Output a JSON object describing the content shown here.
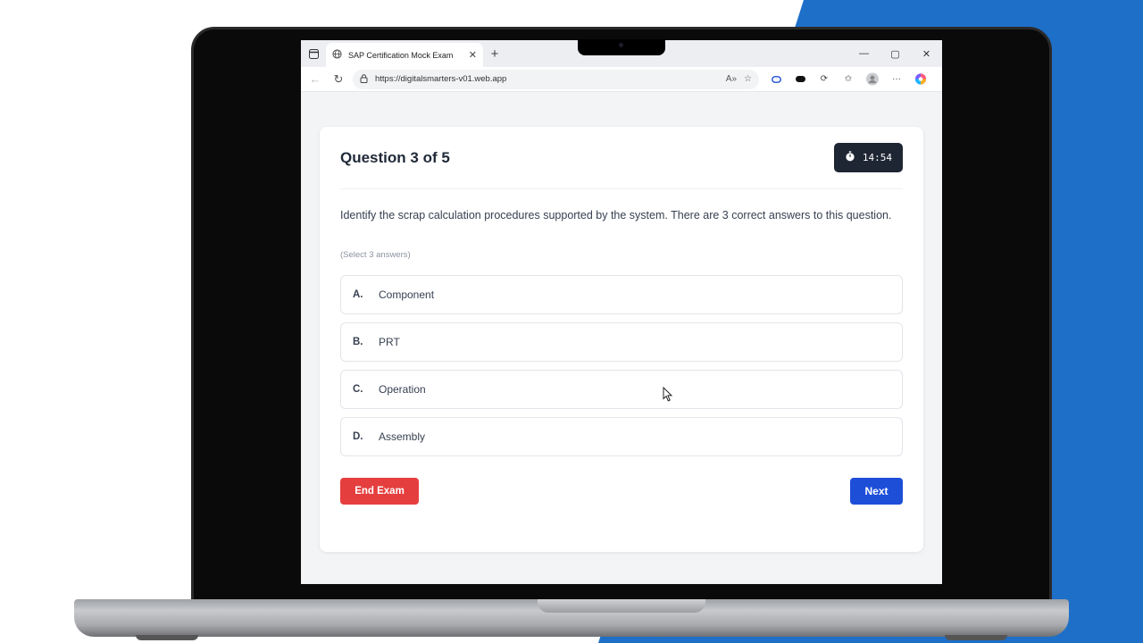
{
  "colors": {
    "accent_blue_bg": "#1e6fc8",
    "timer_bg": "#1e2634",
    "end_button": "#e53e3e",
    "next_button": "#1d4ed8"
  },
  "browser": {
    "tab_title": "SAP Certification Mock Exam",
    "url": "https://digitalsmarters-v01.web.app",
    "icons": [
      "sidebar-icon",
      "globe-icon",
      "close-icon",
      "plus-icon",
      "minimize-icon",
      "maximize-icon",
      "back-icon",
      "refresh-icon",
      "lock-icon",
      "read-aloud-icon",
      "star-icon",
      "extension-icon",
      "favorites-icon",
      "profile-icon",
      "more-icon",
      "copilot-icon"
    ]
  },
  "exam": {
    "question_title": "Question 3 of 5",
    "timer": "14:54",
    "question_text": "Identify the scrap calculation procedures supported by the system. There are 3 correct answers to this question.",
    "hint": "(Select 3 answers)",
    "options": [
      {
        "letter": "A.",
        "text": "Component"
      },
      {
        "letter": "B.",
        "text": "PRT"
      },
      {
        "letter": "C.",
        "text": "Operation"
      },
      {
        "letter": "D.",
        "text": "Assembly"
      }
    ],
    "end_label": "End Exam",
    "next_label": "Next"
  }
}
